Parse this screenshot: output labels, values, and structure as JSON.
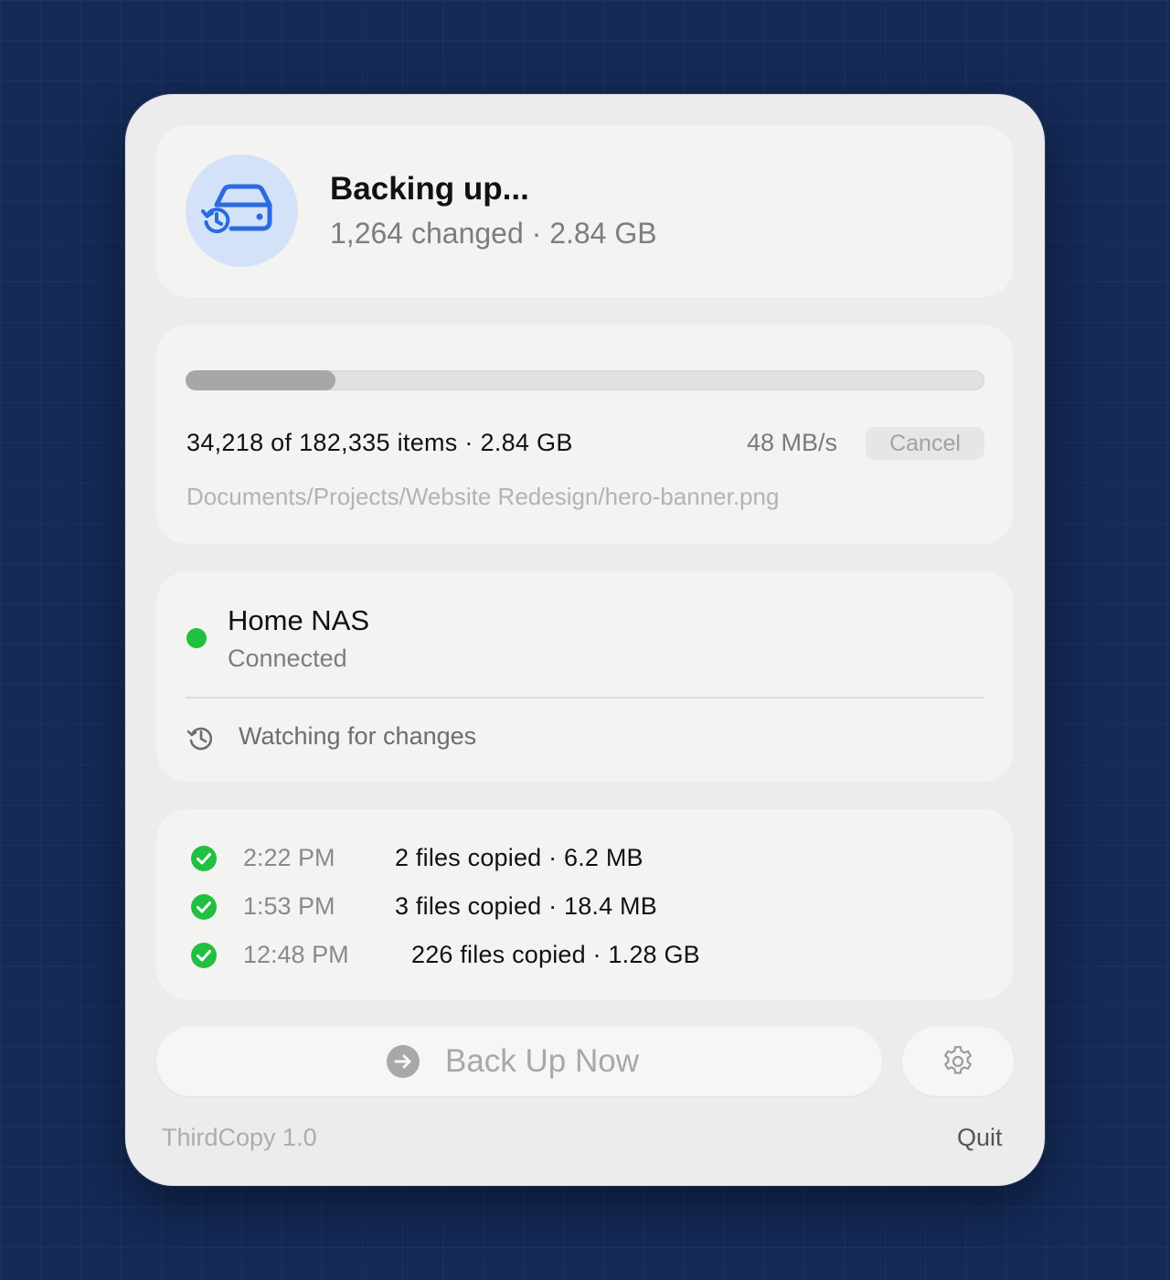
{
  "header": {
    "title": "Backing up...",
    "subtitle": "1,264 changed · 2.84 GB",
    "icon": "drive-history-icon",
    "icon_color": "#2a6be0"
  },
  "progress": {
    "fraction": 0.1877,
    "items_text": "34,218 of 182,335 items · 2.84 GB",
    "speed": "48 MB/s",
    "cancel_label": "Cancel",
    "current_path": "Documents/Projects/Website Redesign/hero-banner.png"
  },
  "destination": {
    "name": "Home NAS",
    "status": "Connected",
    "status_color": "#22c040",
    "watch_text": "Watching for changes",
    "watch_icon": "history-clock-icon"
  },
  "history": [
    {
      "time": "2:22 PM",
      "detail": "2 files copied · 6.2 MB"
    },
    {
      "time": "1:53 PM",
      "detail": "3 files copied · 18.4 MB"
    },
    {
      "time": "12:48 PM",
      "detail": "226 files copied · 1.28 GB"
    }
  ],
  "actions": {
    "backup_label": "Back Up Now",
    "backup_icon": "arrow-right-circle-icon",
    "settings_icon": "gear-icon"
  },
  "footer": {
    "version": "ThirdCopy 1.0",
    "quit_label": "Quit"
  }
}
